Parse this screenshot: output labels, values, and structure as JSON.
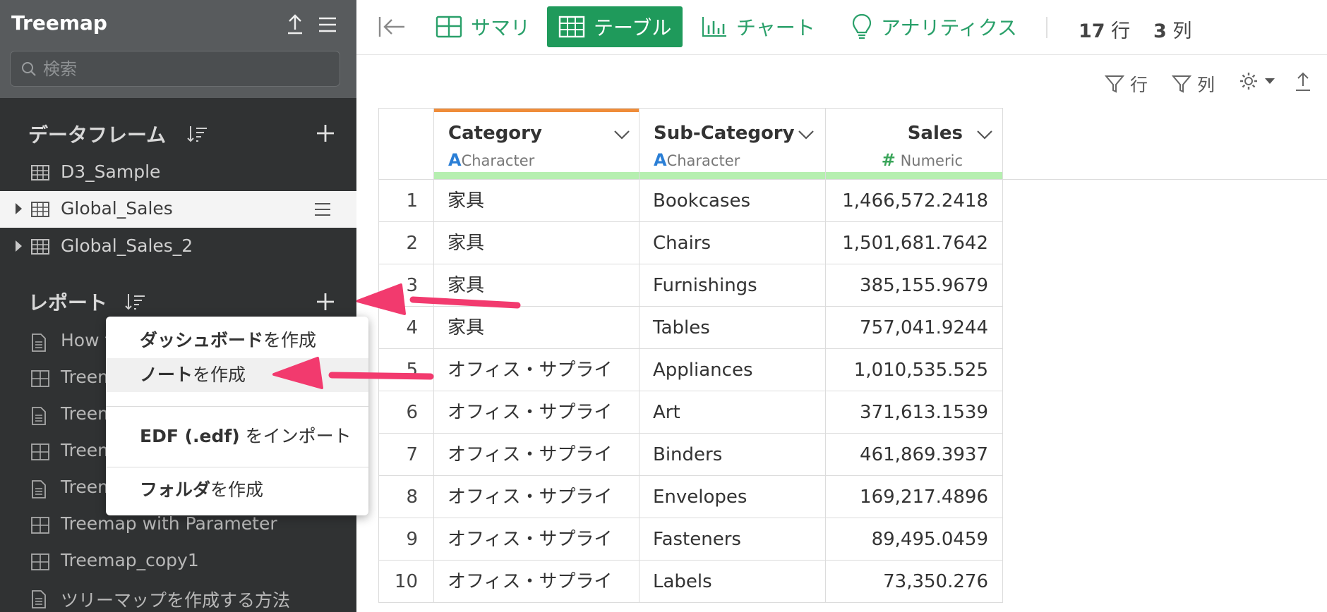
{
  "sidebar": {
    "title": "Treemap",
    "search": {
      "placeholder": "検索"
    },
    "dataframes": {
      "header": "データフレーム",
      "items": [
        {
          "label": "D3_Sample",
          "expandable": false,
          "selected": false
        },
        {
          "label": "Global_Sales",
          "expandable": true,
          "selected": true
        },
        {
          "label": "Global_Sales_2",
          "expandable": true,
          "selected": false
        }
      ]
    },
    "reports": {
      "header": "レポート",
      "items": [
        {
          "label": "How t",
          "icon": "note-icon"
        },
        {
          "label": "Treem",
          "icon": "dashboard-icon"
        },
        {
          "label": "Treem",
          "icon": "note-icon"
        },
        {
          "label": "Treem",
          "icon": "dashboard-icon"
        },
        {
          "label": "Treem",
          "icon": "note-icon"
        },
        {
          "label": "Treemap with Parameter",
          "icon": "dashboard-icon"
        },
        {
          "label": "Treemap_copy1",
          "icon": "dashboard-icon"
        },
        {
          "label": "ツリーマップを作成する方法",
          "icon": "note-icon"
        }
      ]
    }
  },
  "menu": {
    "items": [
      {
        "bold": "ダッシュボード",
        "rest": "を作成"
      },
      {
        "bold": "ノート",
        "rest": "を作成"
      },
      {
        "bold": "EDF (.edf)",
        "rest": " をインポート"
      },
      {
        "bold": "フォルダ",
        "rest": "を作成"
      }
    ]
  },
  "toolbar": {
    "tabs": [
      "サマリ",
      "テーブル",
      "チャート",
      "アナリティクス"
    ],
    "active_tab": "テーブル",
    "rows_count": "17",
    "rows_label": "行",
    "cols_count": "3",
    "cols_label": "列"
  },
  "subbar": {
    "filter_rows": "行",
    "filter_cols": "列"
  },
  "table": {
    "columns": [
      {
        "name": "Category",
        "type": "Character",
        "type_glyph": "A"
      },
      {
        "name": "Sub-Category",
        "type": "Character",
        "type_glyph": "A"
      },
      {
        "name": "Sales",
        "type": "Numeric",
        "type_glyph": "#"
      }
    ],
    "rows": [
      [
        "1",
        "家具",
        "Bookcases",
        "1,466,572.2418"
      ],
      [
        "2",
        "家具",
        "Chairs",
        "1,501,681.7642"
      ],
      [
        "3",
        "家具",
        "Furnishings",
        "385,155.9679"
      ],
      [
        "4",
        "家具",
        "Tables",
        "757,041.9244"
      ],
      [
        "5",
        "オフィス・サプライ",
        "Appliances",
        "1,010,535.525"
      ],
      [
        "6",
        "オフィス・サプライ",
        "Art",
        "371,613.1539"
      ],
      [
        "7",
        "オフィス・サプライ",
        "Binders",
        "461,869.3937"
      ],
      [
        "8",
        "オフィス・サプライ",
        "Envelopes",
        "169,217.4896"
      ],
      [
        "9",
        "オフィス・サプライ",
        "Fasteners",
        "89,495.0459"
      ],
      [
        "10",
        "オフィス・サプライ",
        "Labels",
        "73,350.276"
      ]
    ]
  },
  "colors": {
    "accent_green": "#1f9a5b",
    "annotation_arrow": "#f23a6e",
    "sidebar_bg": "#303233"
  }
}
